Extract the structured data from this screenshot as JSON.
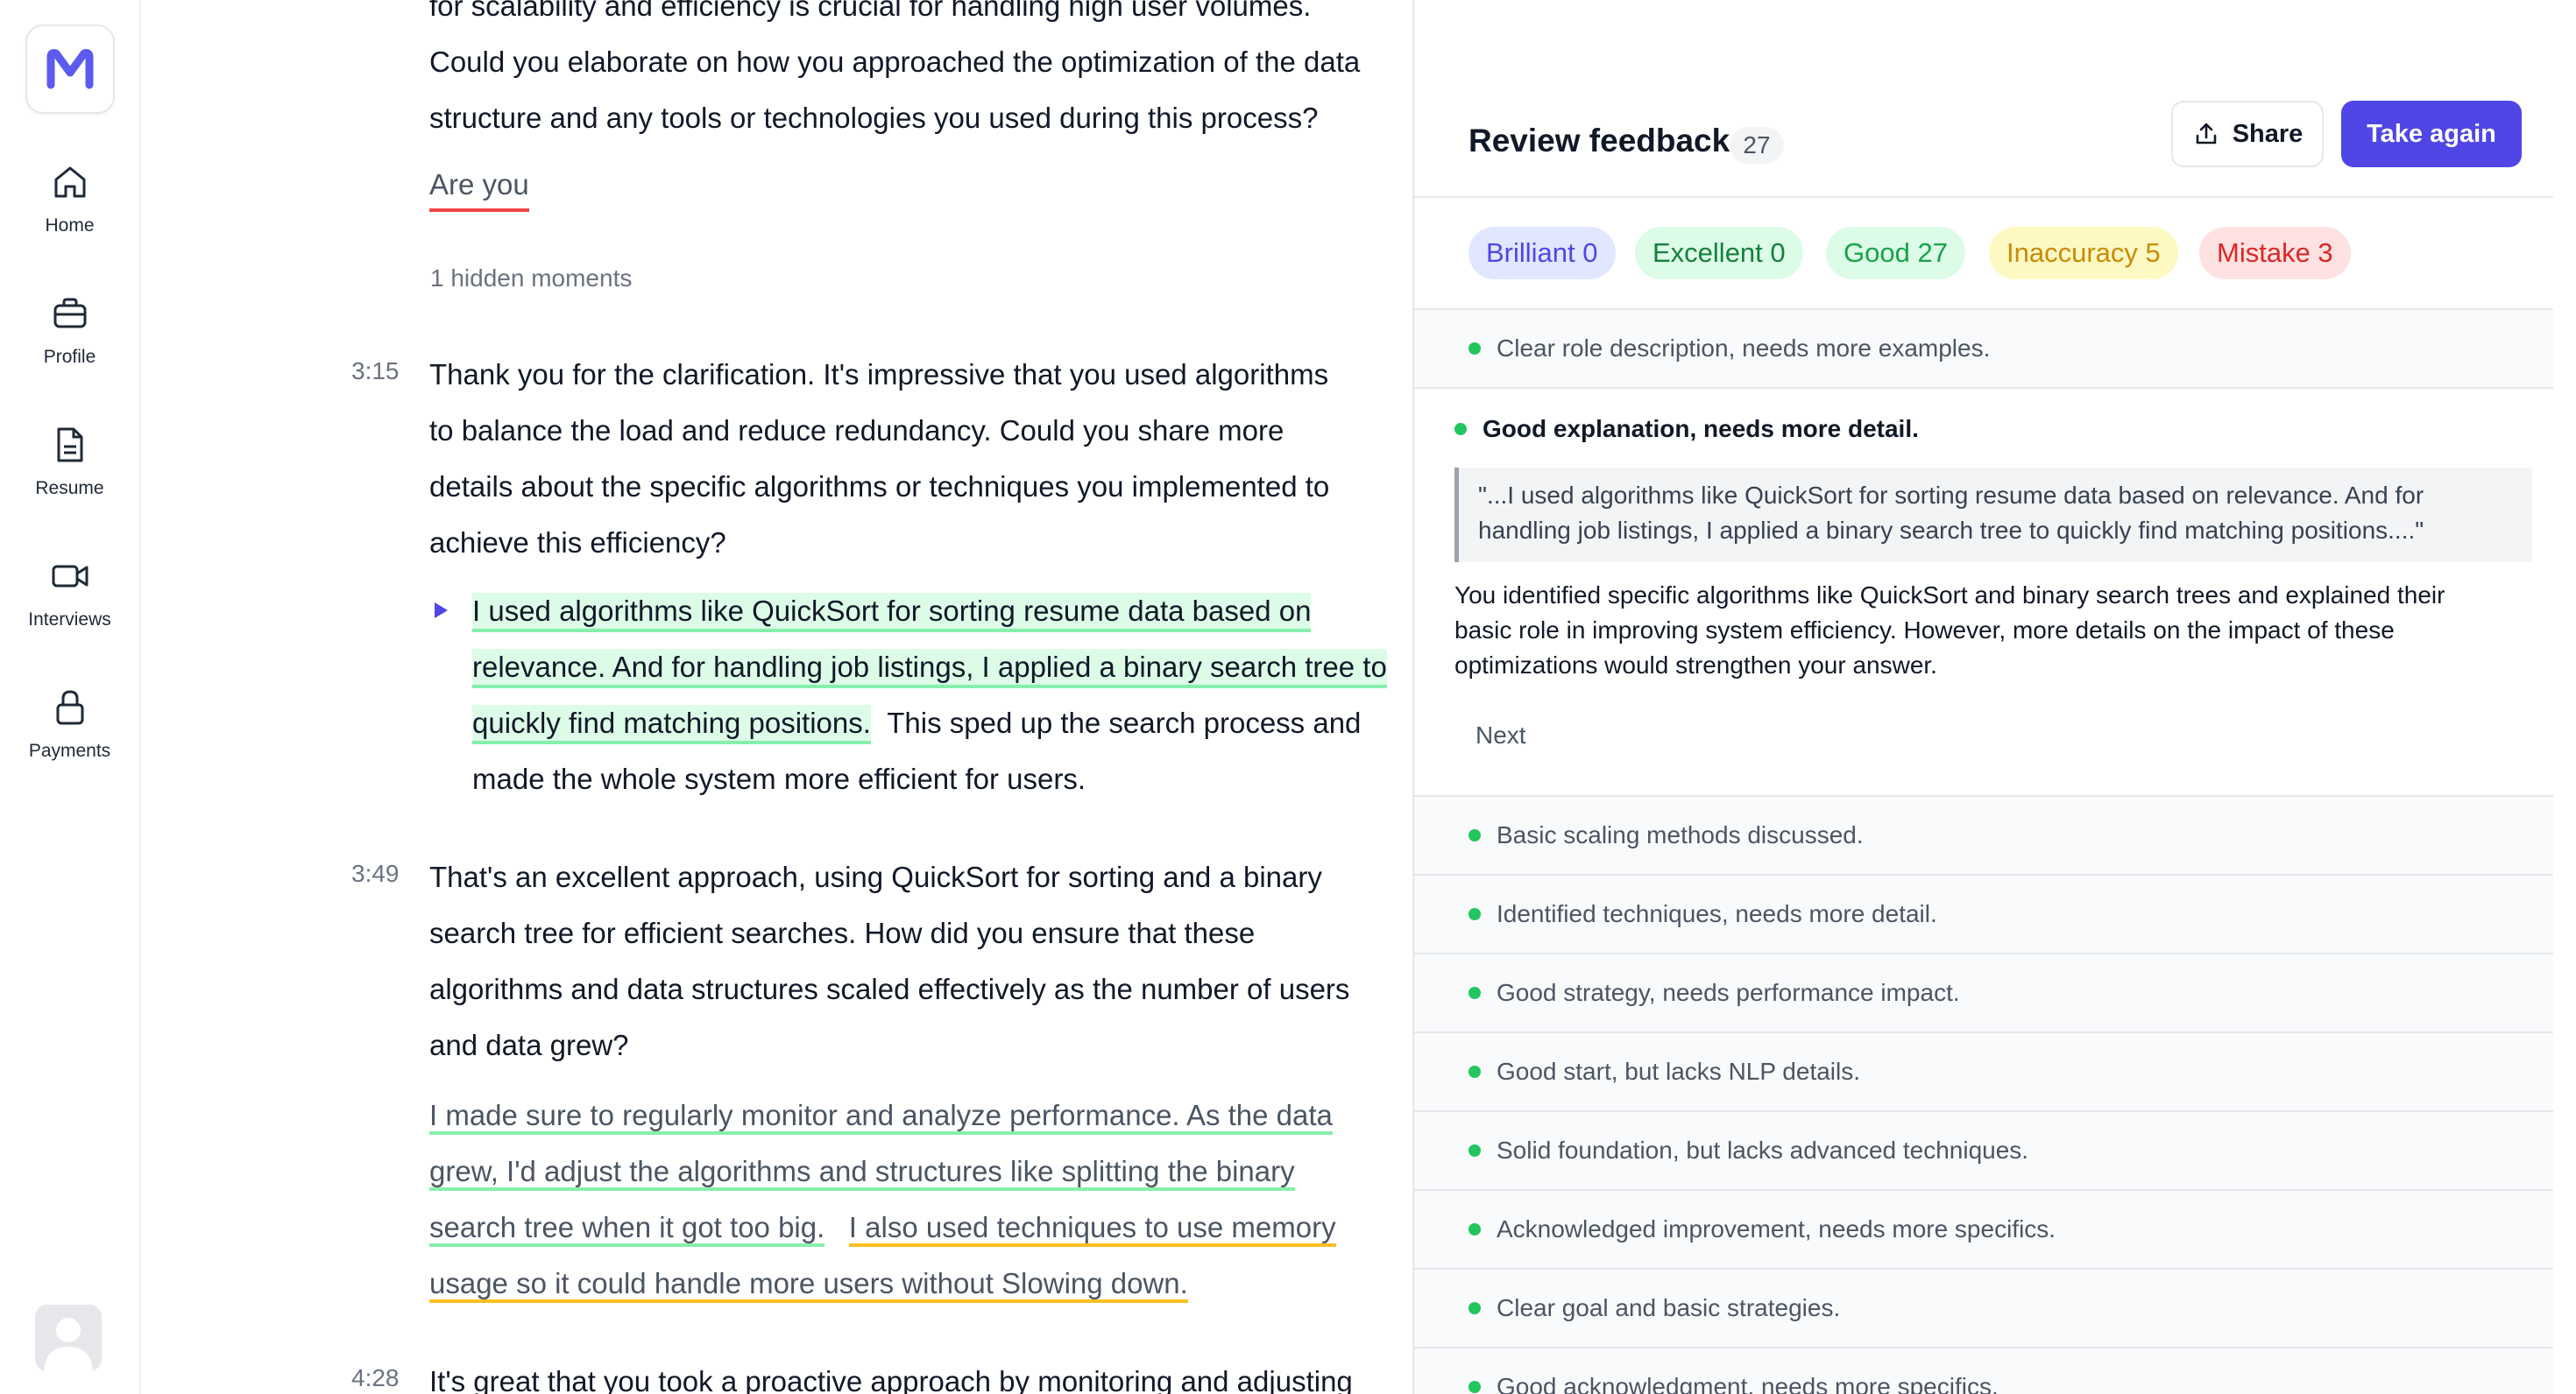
{
  "sidebar": {
    "logo": "M",
    "items": [
      {
        "label": "Home",
        "icon": "home-icon"
      },
      {
        "label": "Profile",
        "icon": "briefcase-icon"
      },
      {
        "label": "Resume",
        "icon": "document-icon"
      },
      {
        "label": "Interviews",
        "icon": "video-camera-icon"
      },
      {
        "label": "Payments",
        "icon": "lock-icon"
      }
    ]
  },
  "transcript": {
    "intro_lines": [
      "for scalability and efficiency is crucial for handling high user volumes.",
      "Could you elaborate on how you approached the optimization of the data",
      "structure and any tools or technologies you used during this process?"
    ],
    "answer_partial": "Are you",
    "hidden_moments": "1 hidden moments",
    "entries": [
      {
        "time": "3:15",
        "question_lines": [
          "Thank you for the clarification. It's impressive that you used algorithms",
          "to balance the load and reduce redundancy. Could you share more",
          "details about the specific algorithms or techniques you implemented to",
          "achieve this efficiency?"
        ],
        "answer_highlight_lines": [
          "I used algorithms like QuickSort for sorting resume data based on",
          "relevance. And for handling job listings, I applied a binary search tree to",
          "quickly find matching positions."
        ],
        "answer_rest_lines": [
          "This sped up the search process and",
          "made the whole system more efficient for users."
        ]
      },
      {
        "time": "3:49",
        "question_lines": [
          "That's an excellent approach, using QuickSort for sorting and a binary",
          "search tree for efficient searches. How did you ensure that these",
          "algorithms and data structures scaled effectively as the number of users",
          "and data grew?"
        ],
        "answer_lines": [
          "I made sure to regularly monitor and analyze performance. As the data",
          "grew, I'd adjust the algorithms and structures like splitting the binary",
          "search tree when it got too big.",
          "I also used techniques to use memory",
          "usage so it could handle more users without Slowing down."
        ]
      },
      {
        "time": "4:28",
        "question_lines": [
          "It's great that you took a proactive approach by monitoring and adjusting"
        ]
      }
    ]
  },
  "review": {
    "title": "Review feedback",
    "count": "27",
    "share_label": "Share",
    "take_again_label": "Take again",
    "chips": [
      {
        "label": "Brilliant 0",
        "color": "#4f46e5"
      },
      {
        "label": "Excellent 0",
        "color": "#15803d"
      },
      {
        "label": "Good 27",
        "color": "#16a34a"
      },
      {
        "label": "Inaccuracy 5",
        "color": "#ca8a04"
      },
      {
        "label": "Mistake 3",
        "color": "#dc2626"
      }
    ],
    "first_item": "Clear role description, needs more examples.",
    "expanded": {
      "title": "Good explanation, needs more detail.",
      "quote_lines": [
        "\"...I used algorithms like QuickSort for sorting resume data based on relevance. And for",
        "handling job listings, I applied a binary search tree to quickly find matching positions....\""
      ],
      "body_lines": [
        "You identified specific algorithms like QuickSort and binary search trees and explained their",
        "basic role in improving system efficiency. However, more details on the impact of these",
        "optimizations would strengthen your answer."
      ],
      "next_label": "Next"
    },
    "items": [
      "Basic scaling methods discussed.",
      "Identified techniques, needs more detail.",
      "Good strategy, needs performance impact.",
      "Good start, but lacks NLP details.",
      "Solid foundation, but lacks advanced techniques.",
      "Acknowledged improvement, needs more specifics.",
      "Clear goal and basic strategies.",
      "Good acknowledgment, needs more specifics."
    ],
    "accent_color": "#4f46e5",
    "good_dot_color": "#22c55e"
  }
}
